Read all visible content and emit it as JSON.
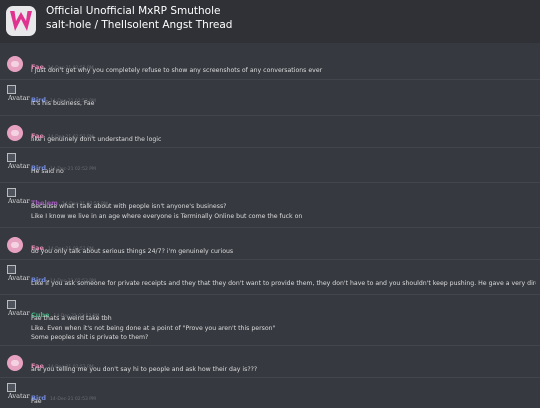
{
  "header": {
    "title": "Official Unofficial MxRP Smuthole",
    "subtitle": "salt-hole / TheIlsolent Angst Thread"
  },
  "colors": {
    "background": "#36393f",
    "header": "#2f3136",
    "text": "#dcddde",
    "fae": "#e58cb5",
    "bird": "#7289da",
    "thelem": "#9b59b6",
    "cube": "#43b581"
  },
  "avatar_alt": "Avatar",
  "messages": [
    {
      "author": "Fae",
      "time": "14-Dec-21 02:52 PM",
      "lines": [
        "i just don't get why you completely refuse to show any screenshots of any conversations ever"
      ]
    },
    {
      "author": "Bird",
      "time": "14-Dec-21 02:52 PM",
      "lines": [
        "It's his business, Fae"
      ]
    },
    {
      "author": "Fae",
      "time": "14-Dec-21 02:52 PM",
      "lines": [
        "like i genuinely don't understand the logic"
      ]
    },
    {
      "author": "Bird",
      "time": "14-Dec-21 02:52 PM",
      "lines": [
        "He said no"
      ]
    },
    {
      "author": "Thelem",
      "time": "14-Dec-21 02:52 PM",
      "lines": [
        "Because what I talk about with people isn't anyone's business?",
        "Like I know we live in an age where everyone is Terminally Online but come the fuck on"
      ]
    },
    {
      "author": "Fae",
      "time": "14-Dec-21 02:52 PM",
      "lines": [
        "do you only talk about serious things 24/7? i'm genuinely curious"
      ]
    },
    {
      "author": "Bird",
      "time": "14-Dec-21 02:53 PM",
      "lines": [
        "Like if you ask someone for private receipts and they that they don't want to provide them, they don't have to and you shouldn't keep pushing. He gave a very direct answer."
      ]
    },
    {
      "author": "Cube",
      "time": "14-Dec-21 02:53 PM",
      "lines": [
        "Fae thats a weird take tbh",
        "Like. Even when it's not being done at a point of \"Prove you aren't this person\"",
        "Some peoples shit is private to them?"
      ]
    },
    {
      "author": "Fae",
      "time": "14-Dec-21 02:53 PM",
      "lines": [
        "are you telling me you don't say hi to people and ask how their day is???"
      ]
    },
    {
      "author": "Bird",
      "time": "14-Dec-21 02:53 PM",
      "lines": [
        "Fae"
      ]
    }
  ]
}
